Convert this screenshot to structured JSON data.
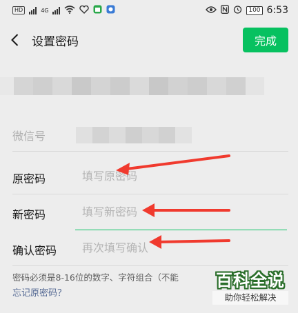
{
  "status_bar": {
    "left_chip": "HD",
    "network_label": "4G",
    "battery": "100",
    "time": "6:53"
  },
  "nav": {
    "title": "设置密码",
    "done_label": "完成"
  },
  "fields": {
    "wechat_id_label": "微信号",
    "old_password_label": "原密码",
    "old_password_placeholder": "填写原密码",
    "new_password_label": "新密码",
    "new_password_placeholder": "填写新密码",
    "confirm_password_label": "确认密码",
    "confirm_password_placeholder": "再次填写确认"
  },
  "hint_text": "密码必须是8-16位的数字、字符组合（不能",
  "forgot_link": "忘记原密码？",
  "watermark": {
    "main": "百科全说",
    "sub": "助你轻松解决"
  },
  "colors": {
    "accent": "#07c160",
    "link": "#576b95",
    "annotation_arrow": "#f03a2e"
  }
}
